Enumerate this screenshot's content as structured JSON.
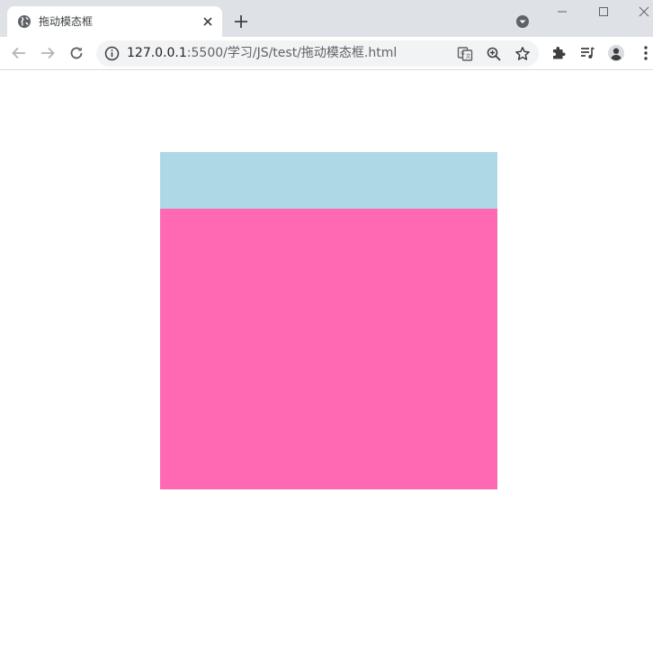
{
  "browser": {
    "tab": {
      "title": "拖动模态框",
      "favicon": "globe-icon"
    },
    "address": {
      "host": "127.0.0.1",
      "path": ":5500/学习/JS/test/拖动模态框.html"
    },
    "icons": {
      "back": "arrow-left-icon",
      "forward": "arrow-right-icon",
      "reload": "reload-icon",
      "info": "info-icon",
      "translate": "translate-icon",
      "zoom": "zoom-icon",
      "bookmark": "star-icon",
      "extensions": "puzzle-icon",
      "media": "playlist-icon",
      "profile": "avatar-icon",
      "menu": "kebab-icon"
    }
  },
  "page": {
    "background": "#ffffff",
    "modal": {
      "header_color": "#add8e6",
      "body_color": "#ff69b4"
    }
  }
}
